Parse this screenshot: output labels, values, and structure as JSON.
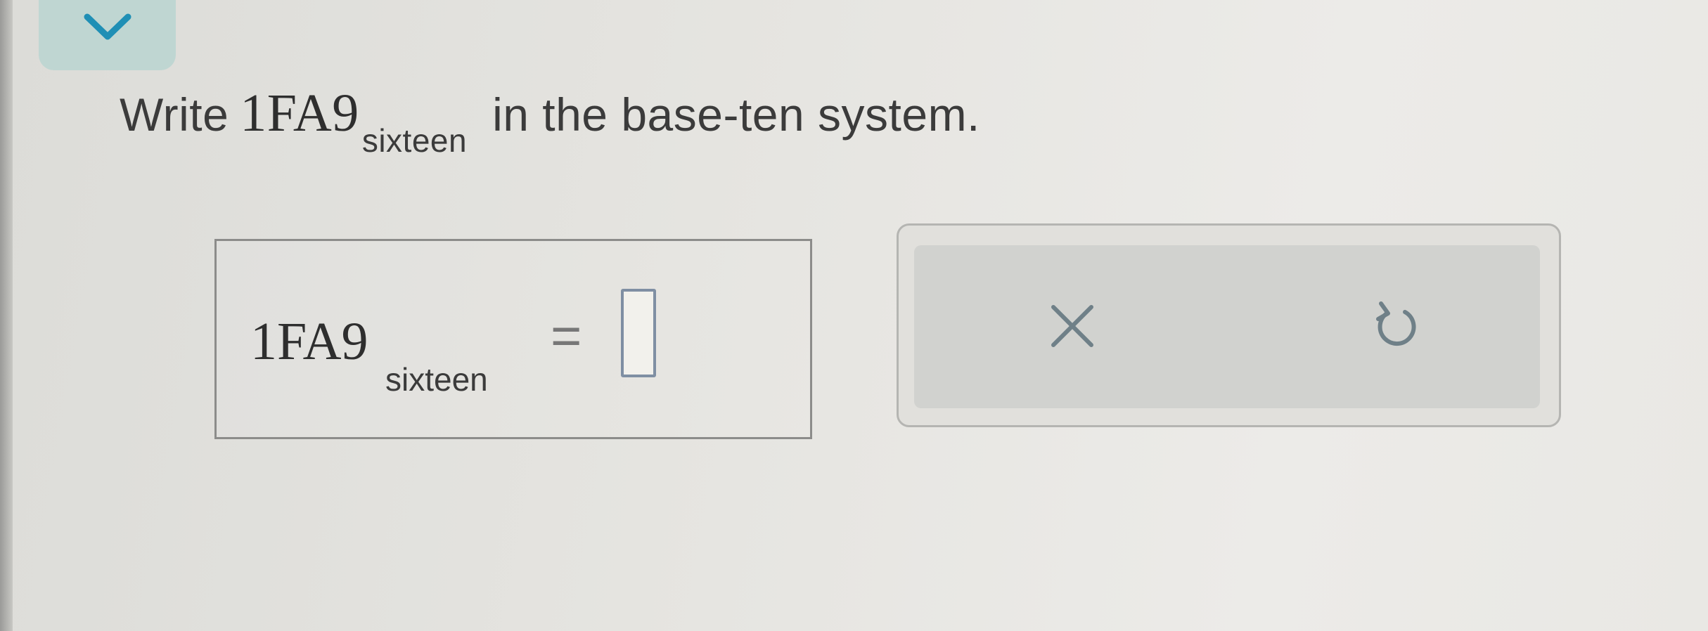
{
  "collapse": {
    "icon": "chevron-down-icon",
    "color": "#1f8fb5"
  },
  "question": {
    "prefix": "Write",
    "number": "1FA9",
    "base": "sixteen",
    "suffix": "in the base-ten system."
  },
  "answer": {
    "number": "1FA9",
    "base": "sixteen",
    "equals": "=",
    "value": ""
  },
  "tools": {
    "clear_icon": "close-icon",
    "undo_icon": "undo-icon",
    "icon_color": "#6f8088"
  }
}
